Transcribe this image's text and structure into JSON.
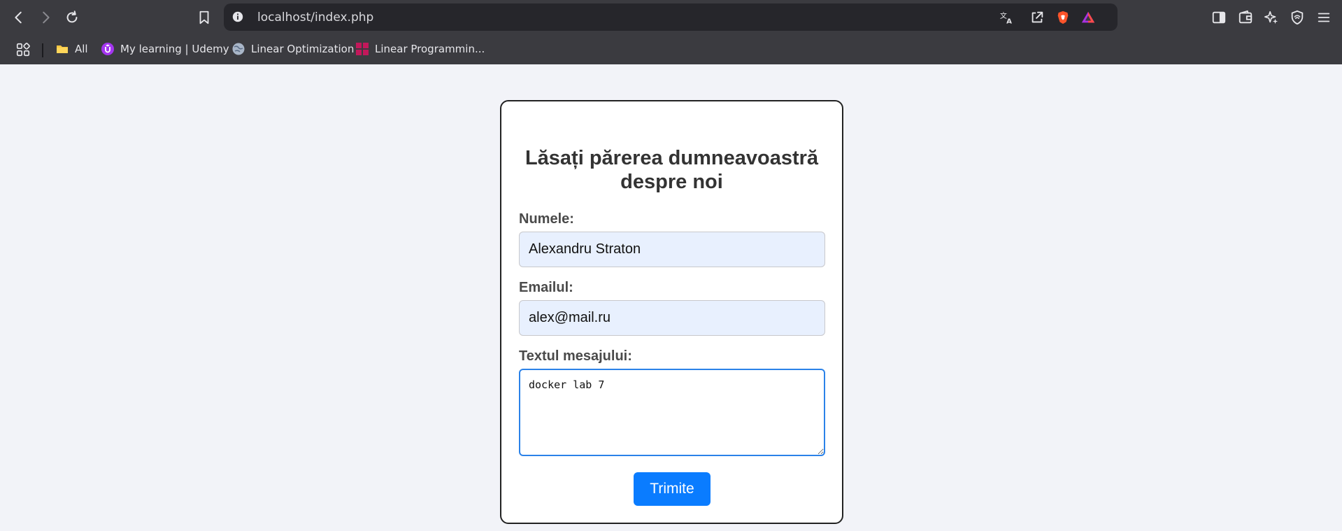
{
  "browser": {
    "url": "localhost/index.php",
    "bookmarks": [
      {
        "label": "All",
        "icon": "folder-icon"
      },
      {
        "label": "My learning | Udemy",
        "icon": "udemy-icon"
      },
      {
        "label": "Linear Optimization",
        "icon": "globe-icon"
      },
      {
        "label": "Linear Programmin...",
        "icon": "grid-logo-icon"
      }
    ]
  },
  "form": {
    "title": "Lăsați părerea dumneavoastră despre noi",
    "name_label": "Numele:",
    "name_value": "Alexandru Straton",
    "email_label": "Emailul:",
    "email_value": "alex@mail.ru",
    "message_label": "Textul mesajului:",
    "message_value": "docker lab 7",
    "submit_label": "Trimite"
  },
  "colors": {
    "chrome_bg": "#3b3b40",
    "urlbar_bg": "#26262b",
    "page_bg": "#f2f3f8",
    "input_bg": "#e8f0fe",
    "button_bg": "#0a7cff",
    "brave_orange": "#fb542b"
  }
}
